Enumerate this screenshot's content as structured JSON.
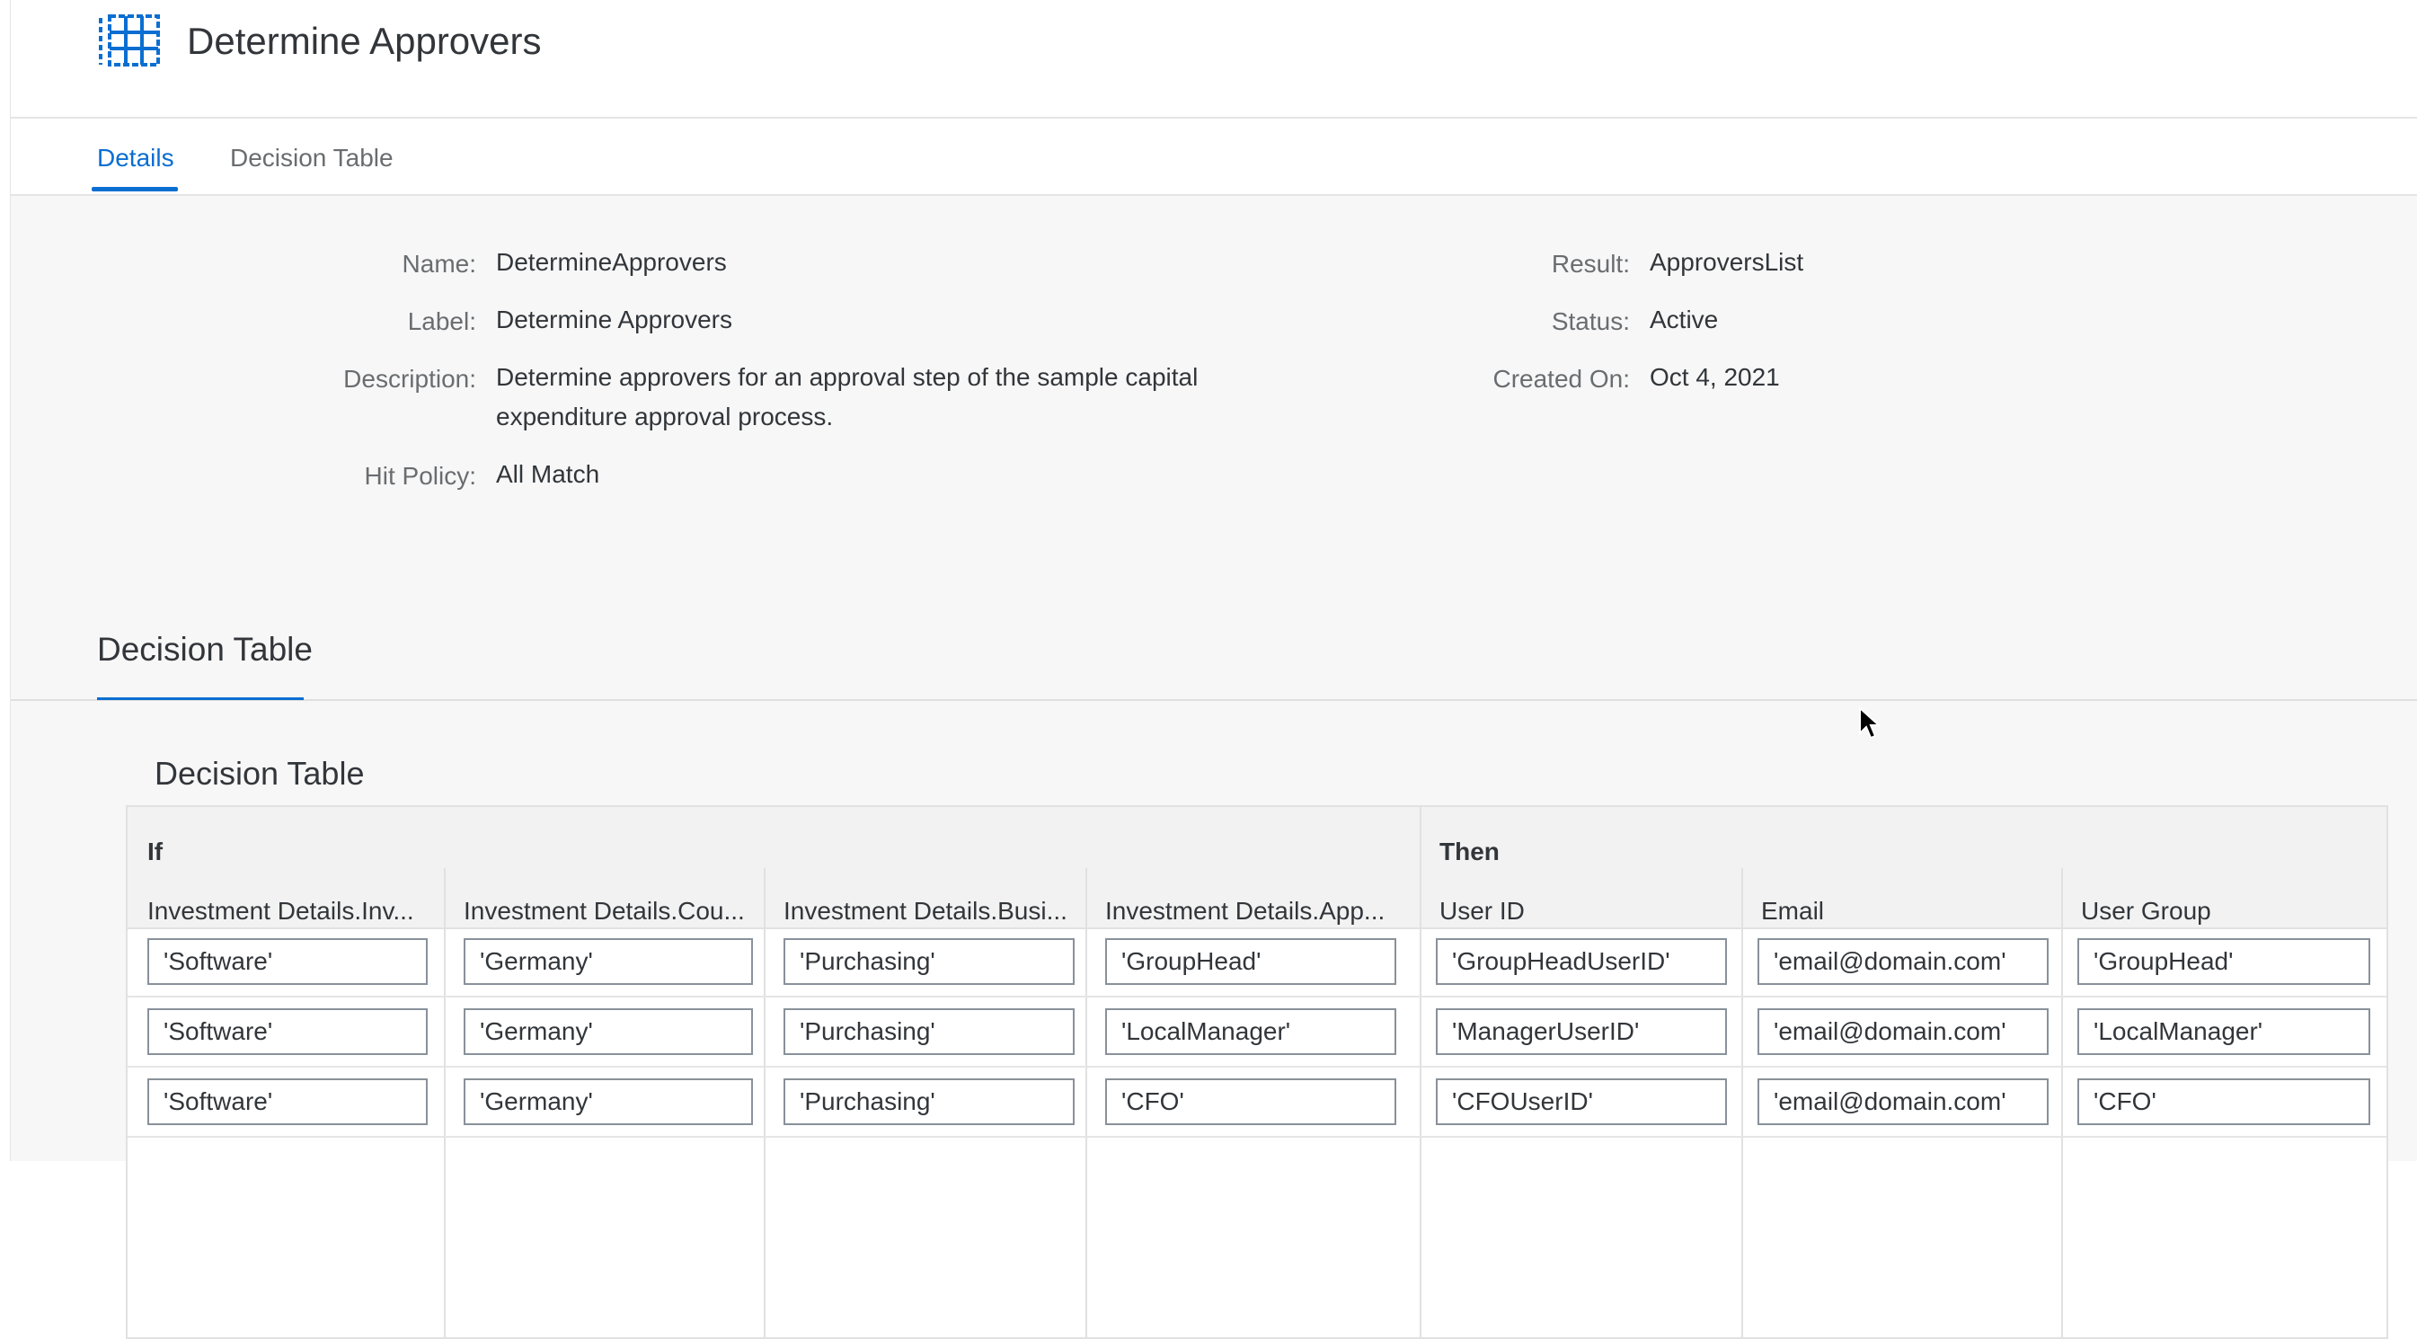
{
  "header": {
    "title": "Determine Approvers",
    "icon": "table-grid-icon"
  },
  "tabs": [
    {
      "label": "Details",
      "active": true
    },
    {
      "label": "Decision Table",
      "active": false
    }
  ],
  "details": {
    "name_label": "Name:",
    "name_value": "DetermineApprovers",
    "label_label": "Label:",
    "label_value": "Determine Approvers",
    "description_label": "Description:",
    "description_line1": "Determine approvers for an approval step of the sample capital",
    "description_line2": "expenditure approval process.",
    "hit_policy_label": "Hit Policy:",
    "hit_policy_value": "All Match",
    "result_label": "Result:",
    "result_value": "ApproversList",
    "status_label": "Status:",
    "status_value": "Active",
    "created_label": "Created On:",
    "created_value": "Oct 4, 2021"
  },
  "section": {
    "title": "Decision Table"
  },
  "decision_table": {
    "title": "Decision Table",
    "if_label": "If",
    "then_label": "Then",
    "columns": [
      "Investment Details.Inv...",
      "Investment Details.Cou...",
      "Investment Details.Busi...",
      "Investment Details.App...",
      "User ID",
      "Email",
      "User Group"
    ],
    "rows": [
      [
        "'Software'",
        "'Germany'",
        "'Purchasing'",
        "'GroupHead'",
        "'GroupHeadUserID'",
        "'email@domain.com'",
        "'GroupHead'"
      ],
      [
        "'Software'",
        "'Germany'",
        "'Purchasing'",
        "'LocalManager'",
        "'ManagerUserID'",
        "'email@domain.com'",
        "'LocalManager'"
      ],
      [
        "'Software'",
        "'Germany'",
        "'Purchasing'",
        "'CFO'",
        "'CFOUserID'",
        "'email@domain.com'",
        "'CFO'"
      ]
    ]
  },
  "colors": {
    "accent": "#0a6ed1",
    "background": "#f7f7f7",
    "text": "#32363a"
  }
}
